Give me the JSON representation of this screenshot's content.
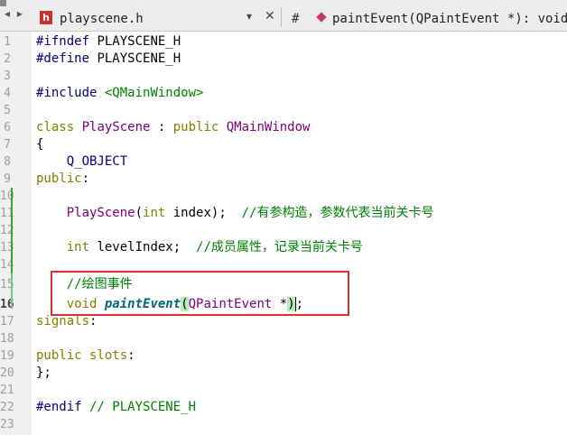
{
  "toolbar": {
    "file_badge": "h",
    "file_name": "playscene.h",
    "hash": "#",
    "method_signature": "paintEvent(QPaintEvent *): void"
  },
  "editor": {
    "line_numbers": [
      "1",
      "2",
      "3",
      "4",
      "5",
      "6",
      "7",
      "8",
      "9",
      "10",
      "11",
      "12",
      "13",
      "14",
      "15",
      "16",
      "17",
      "18",
      "19",
      "20",
      "21",
      "22",
      "23"
    ],
    "current_line": "16",
    "lines": {
      "l1_a": "#ifndef",
      "l1_b": " PLAYSCENE_H",
      "l2_a": "#define",
      "l2_b": " PLAYSCENE_H",
      "l4_a": "#include",
      "l4_b": " <QMainWindow>",
      "l6_a": "class",
      "l6_b": " PlayScene",
      "l6_c": " : ",
      "l6_d": "public",
      "l6_e": " QMainWindow",
      "l7": "{",
      "l8": "    Q_OBJECT",
      "l9_a": "public",
      "l9_b": ":",
      "l11_a": "    PlayScene",
      "l11_b": "(",
      "l11_c": "int",
      "l11_d": " index);  ",
      "l11_e": "//有参构造，参数代表当前关卡号",
      "l13_a": "    int",
      "l13_b": " levelIndex;  ",
      "l13_c": "//成员属性，记录当前关卡号",
      "l15": "    //绘图事件",
      "l16_a": "    void",
      "l16_b": " ",
      "l16_c": "paintEvent",
      "l16_d": "(",
      "l16_e": "QPaintEvent",
      "l16_f": " *",
      "l16_g": ")",
      "l16_h": ";",
      "l17_a": "signals",
      "l17_b": ":",
      "l19_a": "public",
      "l19_b": " slots",
      "l19_c": ":",
      "l20": "};",
      "l22_a": "#endif",
      "l22_b": " // PLAYSCENE_H"
    }
  },
  "colors": {
    "keyword": "#808000",
    "type": "#800080",
    "comment": "#008000",
    "highlight_box": "#e0302c"
  }
}
